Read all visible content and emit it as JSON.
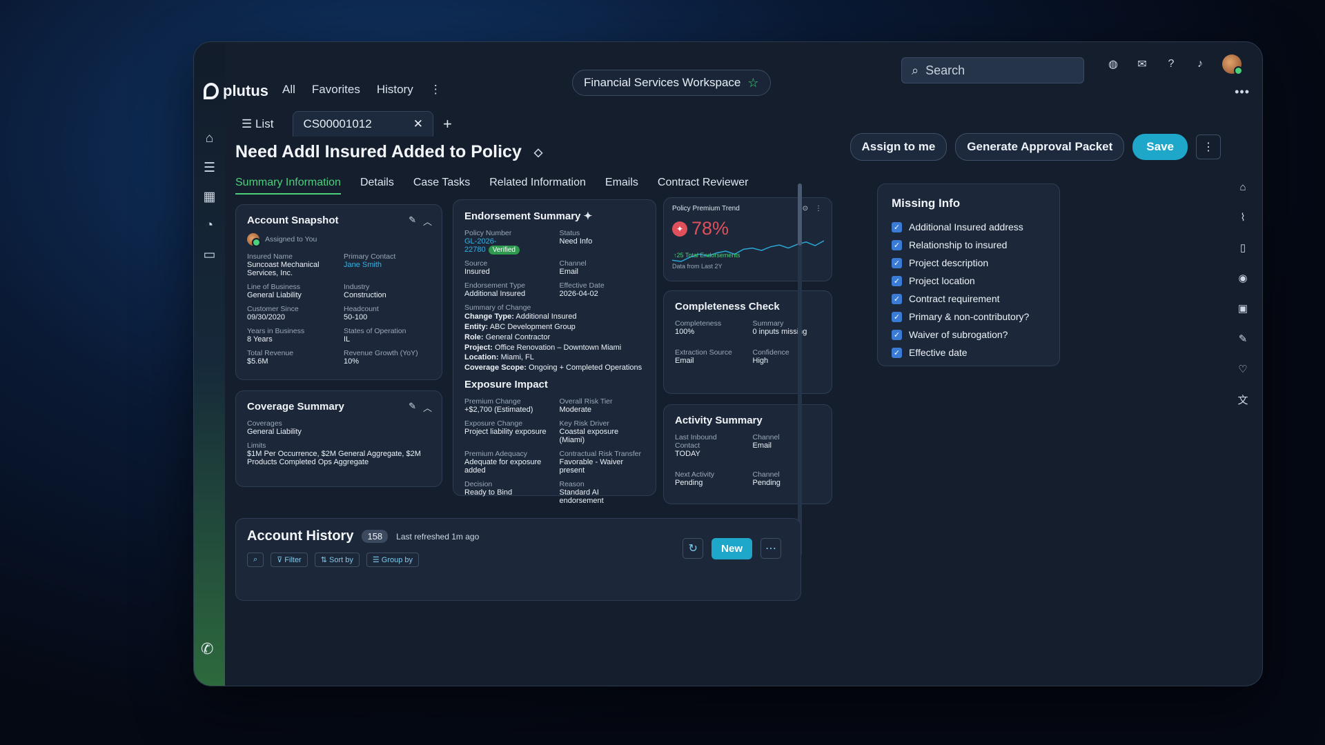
{
  "app": {
    "brand": "plutus",
    "nav": [
      "All",
      "Favorites",
      "History"
    ],
    "workspace": "Financial Services Workspace",
    "search_placeholder": "Search"
  },
  "tabs": {
    "list_label": "List",
    "case_tab": "CS00001012"
  },
  "header": {
    "title": "Need Addl Insured Added to Policy",
    "assign": "Assign to me",
    "generate": "Generate Approval Packet",
    "save": "Save"
  },
  "subtabs": [
    "Summary Information",
    "Details",
    "Case Tasks",
    "Related Information",
    "Emails",
    "Contract Reviewer"
  ],
  "account_snapshot": {
    "title": "Account Snapshot",
    "assigned": "Assigned to You",
    "fields": [
      {
        "label": "Insured Name",
        "value": "Suncoast Mechanical Services, Inc."
      },
      {
        "label": "Primary Contact",
        "value": "Jane Smith"
      },
      {
        "label": "Line of Business",
        "value": "General Liability"
      },
      {
        "label": "Industry",
        "value": "Construction"
      },
      {
        "label": "Customer Since",
        "value": "09/30/2020"
      },
      {
        "label": "Headcount",
        "value": "50-100"
      },
      {
        "label": "Years in Business",
        "value": "8 Years"
      },
      {
        "label": "States of Operation",
        "value": "IL"
      },
      {
        "label": "Total Revenue",
        "value": "$5.6M"
      },
      {
        "label": "Revenue Growth (YoY)",
        "value": "10%"
      }
    ]
  },
  "coverage_summary": {
    "title": "Coverage Summary",
    "coverages_label": "Coverages",
    "coverages": "General Liability",
    "limits_label": "Limits",
    "limits": "$1M Per Occurrence, $2M General Aggregate, $2M Products Completed Ops Aggregate"
  },
  "endorsement": {
    "title": "Endorsement Summary",
    "policy_label": "Policy Number",
    "policy": "GL-2026-22780",
    "verified": "Verified",
    "status_label": "Status",
    "status": "Need Info",
    "source_label": "Source",
    "source": "Insured",
    "channel_label": "Channel",
    "channel": "Email",
    "type_label": "Endorsement Type",
    "type": "Additional Insured",
    "eff_label": "Effective Date",
    "eff": "2026-04-02",
    "change_label": "Summary of Change",
    "changes": [
      {
        "k": "Change Type:",
        "v": "Additional Insured"
      },
      {
        "k": "Entity:",
        "v": "ABC Development Group"
      },
      {
        "k": "Role:",
        "v": "General Contractor"
      },
      {
        "k": "Project:",
        "v": "Office Renovation – Downtown Miami"
      },
      {
        "k": "Location:",
        "v": "Miami, FL"
      },
      {
        "k": "Coverage Scope:",
        "v": "Ongoing + Completed Operations"
      }
    ],
    "exposure_title": "Exposure Impact",
    "exposure": [
      {
        "label": "Premium Change",
        "value": "+$2,700 (Estimated)"
      },
      {
        "label": "Overall Risk Tier",
        "value": "Moderate"
      },
      {
        "label": "Exposure Change",
        "value": "Project liability exposure"
      },
      {
        "label": "Key Risk Driver",
        "value": "Coastal exposure (Miami)"
      },
      {
        "label": "Premium Adequacy",
        "value": "Adequate for exposure added"
      },
      {
        "label": "Contractual Risk Transfer",
        "value": "Favorable - Waiver present"
      },
      {
        "label": "Decision",
        "value": "Ready to Bind"
      },
      {
        "label": "Reason",
        "value": "Standard AI endorsement"
      }
    ]
  },
  "premium_trend": {
    "title": "Policy Premium Trend",
    "value": "78%",
    "sub": "↑25 Total Endorsements",
    "footer": "Data from Last 2Y"
  },
  "chart_data": {
    "type": "line",
    "title": "Policy Premium Trend",
    "values": [
      40,
      38,
      45,
      50,
      47,
      52,
      55,
      50,
      58,
      60,
      56,
      62,
      65,
      60,
      66,
      70,
      64,
      72
    ]
  },
  "completeness": {
    "title": "Completeness Check",
    "fields": [
      {
        "label": "Completeness",
        "value": "100%"
      },
      {
        "label": "Summary",
        "value": "0 inputs missing"
      },
      {
        "label": "Extraction Source",
        "value": "Email"
      },
      {
        "label": "Confidence",
        "value": "High"
      }
    ]
  },
  "activity": {
    "title": "Activity Summary",
    "fields": [
      {
        "label": "Last Inbound Contact",
        "value": "TODAY"
      },
      {
        "label": "Channel",
        "value": "Email"
      },
      {
        "label": "Next Activity",
        "value": "Pending"
      },
      {
        "label": "Channel",
        "value": "Pending"
      }
    ]
  },
  "missing_info": {
    "title": "Missing Info",
    "items": [
      "Additional Insured address",
      "Relationship to insured",
      "Project description",
      "Project location",
      "Contract requirement",
      "Primary & non-contributory?",
      "Waiver of subrogation?",
      "Effective date"
    ]
  },
  "history": {
    "title": "Account History",
    "count": "158",
    "refreshed": "Last refreshed 1m ago",
    "filter": "Filter",
    "sort": "Sort by",
    "group": "Group by",
    "new": "New"
  },
  "colors": {
    "accent": "#1ea7c9",
    "success": "#4ad17a",
    "danger": "#e0505b"
  }
}
